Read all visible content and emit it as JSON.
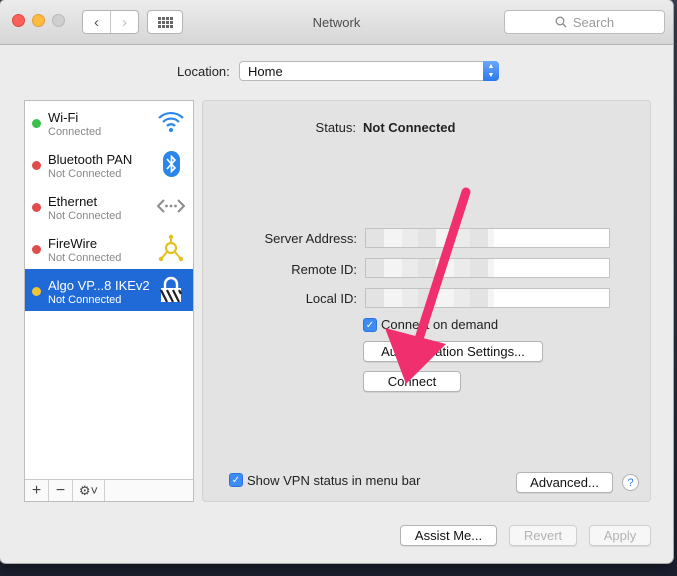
{
  "window": {
    "title": "Network"
  },
  "toolbar": {
    "back": "‹",
    "forward": "›",
    "search_placeholder": "Search"
  },
  "location": {
    "label": "Location:",
    "value": "Home"
  },
  "services": [
    {
      "name": "Wi-Fi",
      "status": "Connected",
      "dot": "#3cc04a",
      "icon": "wifi-icon"
    },
    {
      "name": "Bluetooth PAN",
      "status": "Not Connected",
      "dot": "#e04b4b",
      "icon": "bluetooth-icon"
    },
    {
      "name": "Ethernet",
      "status": "Not Connected",
      "dot": "#e04b4b",
      "icon": "ethernet-icon"
    },
    {
      "name": "FireWire",
      "status": "Not Connected",
      "dot": "#e04b4b",
      "icon": "firewire-icon"
    },
    {
      "name": "Algo VP...8 IKEv2",
      "status": "Not Connected",
      "dot": "#f0c534",
      "icon": "vpn-lock-icon",
      "selected": true
    }
  ],
  "sidebar_footer": {
    "add": "+",
    "remove": "−",
    "gear": "⚙︎˅"
  },
  "detail": {
    "status_label": "Status:",
    "status_value": "Not Connected",
    "server_address_label": "Server Address:",
    "remote_id_label": "Remote ID:",
    "local_id_label": "Local ID:",
    "connect_on_demand": "Connect on demand",
    "auth_settings": "Authentication Settings...",
    "connect": "Connect",
    "show_vpn_status": "Show VPN status in menu bar",
    "advanced": "Advanced...",
    "help": "?"
  },
  "footer": {
    "assist": "Assist Me...",
    "revert": "Revert",
    "apply": "Apply"
  },
  "colors": {
    "accent": "#1f6ad7",
    "arrow": "#f0306e"
  }
}
